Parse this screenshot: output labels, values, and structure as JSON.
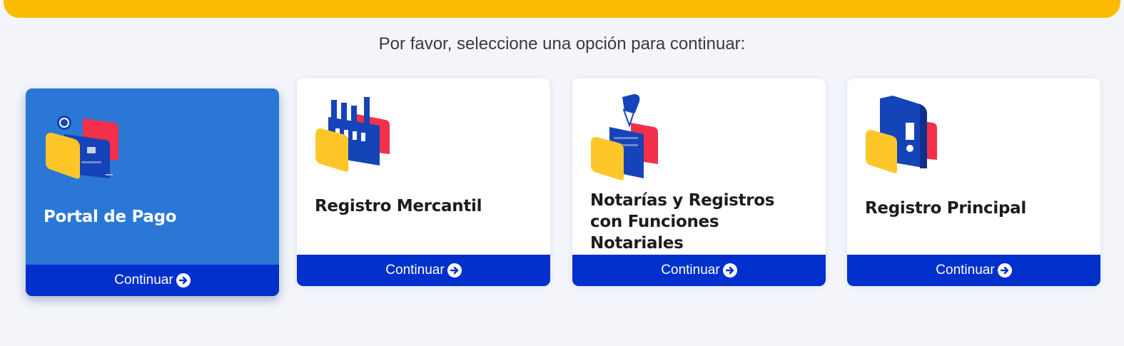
{
  "header": {
    "accent_color": "#fdbb00"
  },
  "prompt": "Por favor, seleccione una opción para continuar:",
  "cards": [
    {
      "title": "Portal de Pago",
      "button_label": "Continuar",
      "icon": "payment-card-icon",
      "active": true
    },
    {
      "title": "Registro Mercantil",
      "button_label": "Continuar",
      "icon": "factory-icon",
      "active": false
    },
    {
      "title": "Notarías y Registros con Funciones Notariales",
      "button_label": "Continuar",
      "icon": "fountain-pen-document-icon",
      "active": false
    },
    {
      "title": "Registro Principal",
      "button_label": "Continuar",
      "icon": "filing-cabinet-icon",
      "active": false
    }
  ],
  "colors": {
    "brand_blue": "#0030cc",
    "active_card": "#2a77d6",
    "yellow": "#fdc629",
    "red": "#f2304a",
    "background": "#f3f5fa"
  }
}
